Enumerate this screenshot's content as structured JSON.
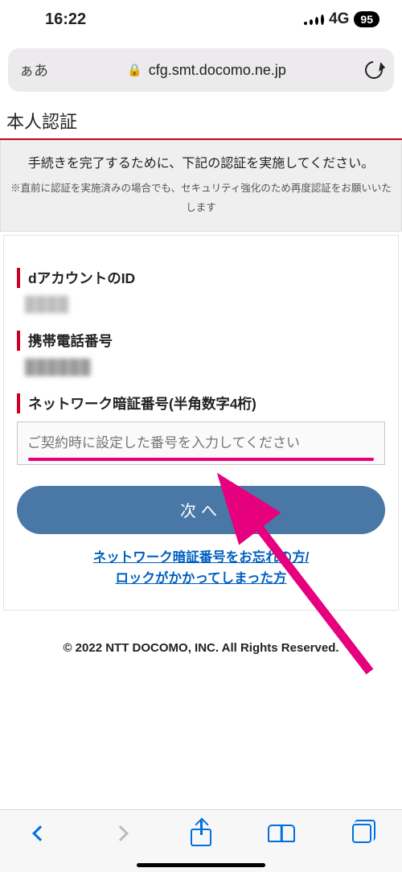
{
  "status": {
    "time": "16:22",
    "network": "4G",
    "battery": "95"
  },
  "address": {
    "aa": "ぁあ",
    "url": "cfg.smt.docomo.ne.jp"
  },
  "section_title": "本人認証",
  "instruction": {
    "main": "手続きを完了するために、下記の認証を実施してください。",
    "sub": "※直前に認証を実施済みの場合でも、セキュリティ強化のため再度認証をお願いいたします"
  },
  "fields": {
    "id_label": "dアカウントのID",
    "id_value": "████",
    "phone_label": "携帯電話番号",
    "phone_value": "██████",
    "pin_label": "ネットワーク暗証番号(半角数字4桁)",
    "pin_placeholder": "ご契約時に設定した番号を入力してください"
  },
  "buttons": {
    "next": "次へ"
  },
  "links": {
    "help": "ネットワーク暗証番号をお忘れの方/\nロックがかかってしまった方"
  },
  "footer": "© 2022 NTT DOCOMO, INC. All Rights Reserved."
}
